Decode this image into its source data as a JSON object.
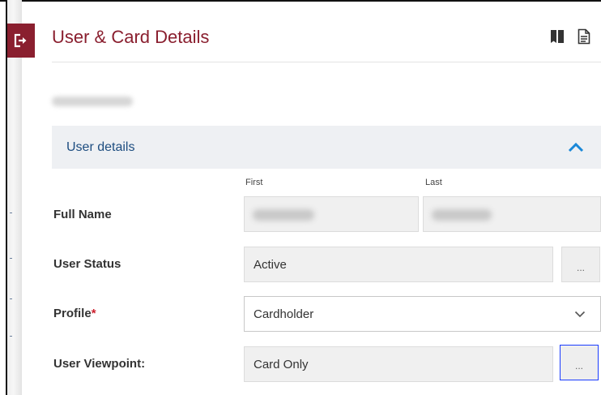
{
  "header": {
    "title": "User & Card Details",
    "exit_icon": "exit-icon",
    "icons": [
      "book-icon",
      "document-icon"
    ]
  },
  "section": {
    "title": "User details",
    "toggle_icon": "chevron-up-icon"
  },
  "columns": {
    "first": "First",
    "last": "Last"
  },
  "rows": {
    "full_name": {
      "label": "Full Name"
    },
    "user_status": {
      "label": "User Status",
      "value": "Active",
      "more": "..."
    },
    "profile": {
      "label": "Profile",
      "required_mark": "*",
      "value": "Cardholder"
    },
    "user_viewpoint": {
      "label": "User Viewpoint:",
      "value": "Card Only",
      "more": "..."
    }
  },
  "colors": {
    "brand": "#8a1f2f",
    "section_title": "#1d4d80",
    "required": "#cc1f2d"
  }
}
